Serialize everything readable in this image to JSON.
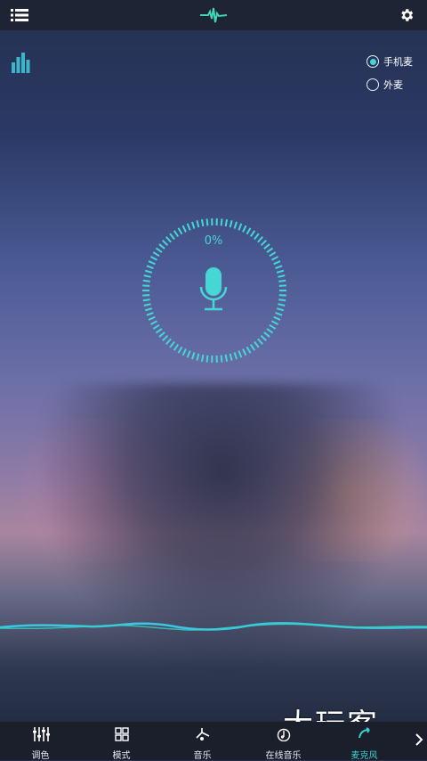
{
  "header": {
    "menu_icon": "menu-list-icon",
    "logo_icon": "waveform-logo-icon",
    "settings_icon": "gear-icon"
  },
  "levels_icon": "bar-levels-icon",
  "source_options": [
    {
      "label": "手机麦",
      "selected": true
    },
    {
      "label": "外麦",
      "selected": false
    }
  ],
  "meter": {
    "percent_text": "0%",
    "level": 0,
    "icon": "microphone-icon"
  },
  "nav": {
    "items": [
      {
        "label": "调色",
        "icon": "equalizer-sliders-icon",
        "active": false
      },
      {
        "label": "模式",
        "icon": "grid-icon",
        "active": false
      },
      {
        "label": "音乐",
        "icon": "music-note-icon",
        "active": false
      },
      {
        "label": "在线音乐",
        "icon": "online-music-icon",
        "active": false
      },
      {
        "label": "麦克风",
        "icon": "microphone-nav-icon",
        "active": true
      }
    ],
    "more_icon": "chevron-right-icon"
  },
  "colors": {
    "accent": "#46d6d6",
    "topbar": "#1f2434",
    "navbar": "#1b1f2c"
  }
}
